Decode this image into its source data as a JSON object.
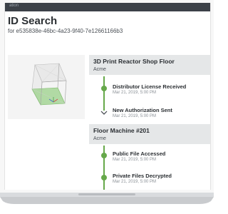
{
  "topbar": {
    "text": "ation"
  },
  "page": {
    "title": "ID Search",
    "subtitle": "for e535838e-46bc-4a23-9f40-7e12661166b3"
  },
  "panels": [
    {
      "title": "3D Print Reactor Shop Floor",
      "owner": "Acme",
      "events": [
        {
          "title": "Distributor License Received",
          "time": "Mar 21, 2019, 5:00 PM"
        },
        {
          "title": "New Authorization Sent",
          "time": "Mar 21, 2019, 5:00 PM"
        }
      ]
    },
    {
      "title": "Floor Machine #201",
      "owner": "Acme",
      "events": [
        {
          "title": "Public File Accessed",
          "time": "Mar 21, 2019, 5:00 PM"
        },
        {
          "title": "Private Files Decrypted",
          "time": "Mar 21, 2019, 5:00 PM"
        }
      ]
    }
  ],
  "colors": {
    "topbar": "#3c4148",
    "panel_header": "#e5e7e8",
    "timeline_green": "#66a84a",
    "model_highlight": "#9bd28a"
  },
  "icons": [
    "cube-model-icon",
    "timeline-dot-icon",
    "chevron-down-icon"
  ]
}
